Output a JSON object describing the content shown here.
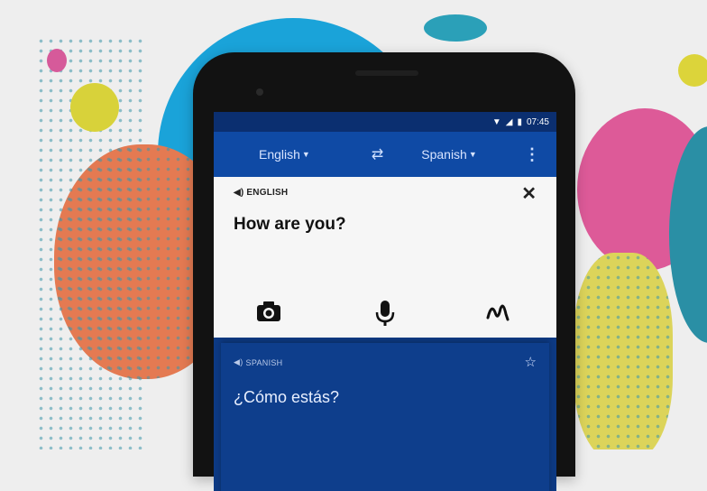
{
  "statusbar": {
    "wifi_icon": "wifi-icon",
    "signal_icon": "signal-icon",
    "battery_icon": "battery-icon",
    "time": "07:45"
  },
  "appbar": {
    "source_language": "English",
    "target_language": "Spanish",
    "swap_icon": "swap-arrows-icon",
    "menu_icon": "more-vert-icon"
  },
  "input_card": {
    "label": "ENGLISH",
    "text": "How are you?",
    "close_icon": "close-icon",
    "tools": [
      "camera-icon",
      "microphone-icon",
      "handwriting-icon"
    ]
  },
  "result_card": {
    "label": "SPANISH",
    "text": "¿Cómo estás?",
    "star_icon": "star-icon"
  },
  "colors": {
    "appbar": "#0f4aa5",
    "statusbar": "#0b2f70",
    "result_card": "#0e3e8c",
    "input_card": "#f6f6f6"
  }
}
